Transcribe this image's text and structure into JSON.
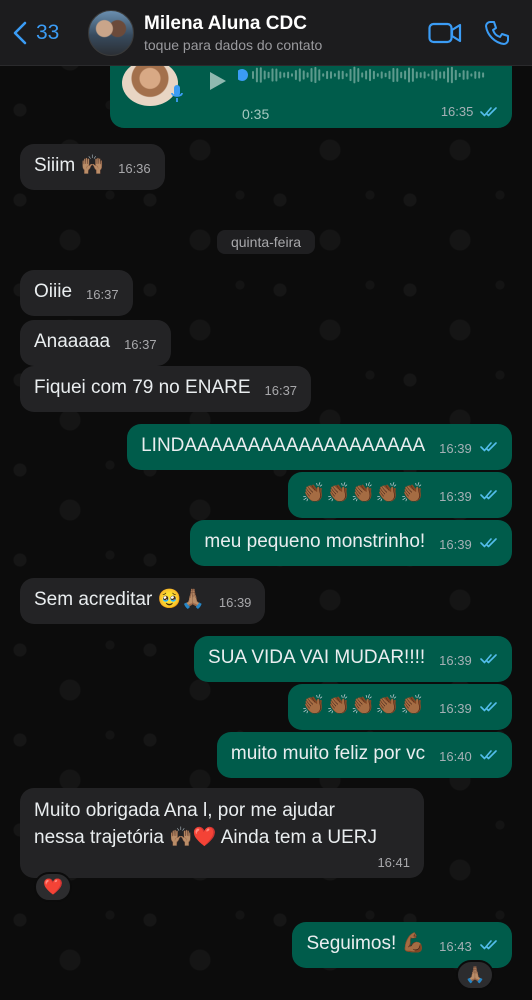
{
  "header": {
    "back_count": "33",
    "contact_name": "Milena Aluna CDC",
    "contact_sub": "toque para dados do contato"
  },
  "voice": {
    "duration": "0:35",
    "time": "16:35"
  },
  "date_separator": "quinta-feira",
  "messages": [
    {
      "dir": "in",
      "text": "Siiim 🙌🏽",
      "time": "16:36"
    },
    {
      "dir": "in",
      "text": "Oiiie",
      "time": "16:37"
    },
    {
      "dir": "in",
      "text": "Anaaaaa",
      "time": "16:37"
    },
    {
      "dir": "in",
      "text": "Fiquei com 79 no ENARE",
      "time": "16:37"
    },
    {
      "dir": "out",
      "text": "LINDAAAAAAAAAAAAAAAAAAA",
      "time": "16:39"
    },
    {
      "dir": "out",
      "text": "👏🏾👏🏾👏🏾👏🏾👏🏾",
      "time": "16:39"
    },
    {
      "dir": "out",
      "text": "meu pequeno monstrinho!",
      "time": "16:39"
    },
    {
      "dir": "in",
      "text": "Sem acreditar 🥹🙏🏽",
      "time": "16:39"
    },
    {
      "dir": "out",
      "text": "SUA VIDA VAI MUDAR!!!!",
      "time": "16:39"
    },
    {
      "dir": "out",
      "text": "👏🏾👏🏾👏🏾👏🏾👏🏾",
      "time": "16:39"
    },
    {
      "dir": "out",
      "text": "muito muito feliz por vc",
      "time": "16:40"
    },
    {
      "dir": "in",
      "line1": "Muito obrigada Ana l, por me ajudar",
      "line2": "nessa trajetória 🙌🏽❤️ Ainda tem a UERJ",
      "time": "16:41",
      "reaction": "❤️"
    },
    {
      "dir": "out",
      "text": "Seguimos! 💪🏾",
      "time": "16:43",
      "reaction": "🙏🏽"
    }
  ],
  "colors": {
    "accent": "#3b9cf5",
    "outgoing_bubble": "#005c4b",
    "incoming_bubble": "#232325",
    "read_ticks": "#53bdeb"
  }
}
